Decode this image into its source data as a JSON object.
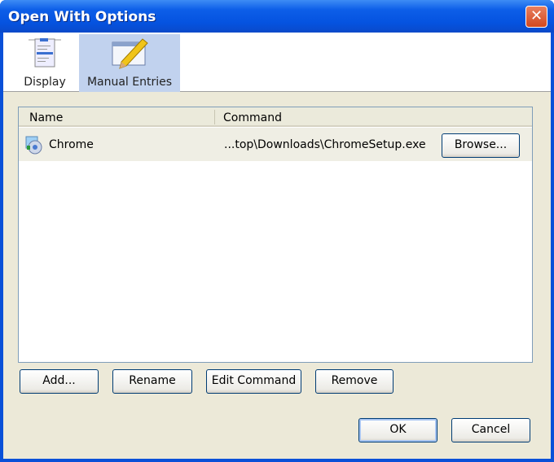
{
  "window": {
    "title": "Open With Options"
  },
  "tabs": [
    {
      "label": "Display",
      "selected": false
    },
    {
      "label": "Manual Entries",
      "selected": true
    }
  ],
  "list": {
    "columns": [
      "Name",
      "Command"
    ],
    "rows": [
      {
        "name": "Chrome",
        "command": "...top\\Downloads\\ChromeSetup.exe",
        "browse_label": "Browse..."
      }
    ]
  },
  "buttons": {
    "add": "Add...",
    "rename": "Rename",
    "edit_command": "Edit Command",
    "remove": "Remove",
    "ok": "OK",
    "cancel": "Cancel"
  },
  "icons": {
    "close": "✕"
  }
}
